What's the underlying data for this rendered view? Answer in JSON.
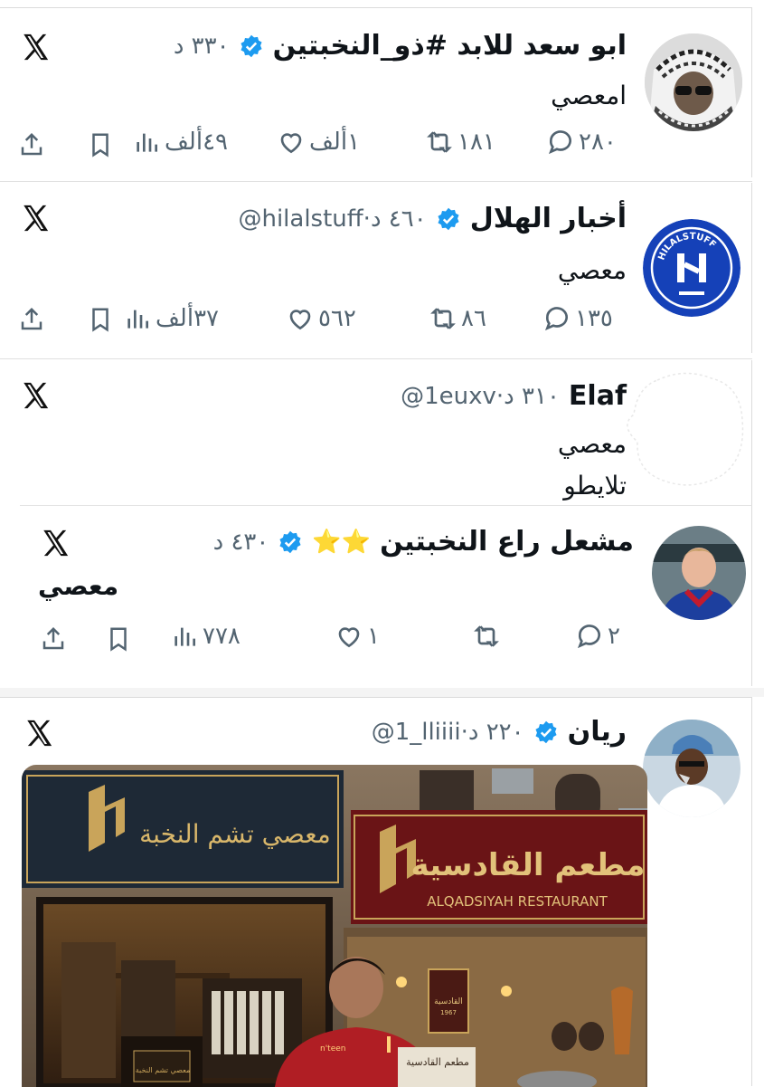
{
  "colors": {
    "verified": "#1d9bf0",
    "muted": "#536471",
    "text": "#0f1419",
    "hilal_blue": "#1541b8"
  },
  "tweet1": {
    "name": "ابو سعد للابد #ذو_النخبتين",
    "meta": "٣٣٠ د",
    "text": "امعصي",
    "actions": {
      "reply": "٢٨٠",
      "retweet": "١٨١",
      "like": "١ألف",
      "views": "٤٩ألف"
    }
  },
  "tweet2": {
    "name": "أخبار الهلال",
    "meta": "@hilalstuff·٤٦٠ د",
    "text": "معصي",
    "actions": {
      "reply": "١٣٥",
      "retweet": "٨٦",
      "like": "٥٦٢",
      "views": "٣٧ألف"
    },
    "avatar_label": "HILALSTUFF"
  },
  "tweet3": {
    "name": "Elaf",
    "meta": "@1euxv·٣١٠ د",
    "text_line1": "معصي",
    "text_line2": "تلايطو"
  },
  "tweet4": {
    "name": "مشعل راع النخبتين",
    "stars": "⭐⭐",
    "meta": "٤٣٠ د",
    "text": "معصي",
    "actions": {
      "reply": "٢",
      "like": "١",
      "views": "٧٧٨"
    }
  },
  "tweet5": {
    "name": "ريان",
    "meta": "@1_lliiii·٢٢٠ د",
    "image": {
      "sign_left": "معصي تشم النخبة",
      "sign_right_ar": "مطعم القادسية",
      "sign_right_en": "ALQADSIYAH RESTAURANT",
      "small_sign": "القادسية",
      "small_sign_year": "1967",
      "shop_sign": "معصي تشم النخبة",
      "shirt_brand": "n'teen",
      "board_text": "مطعم القادسية"
    }
  }
}
